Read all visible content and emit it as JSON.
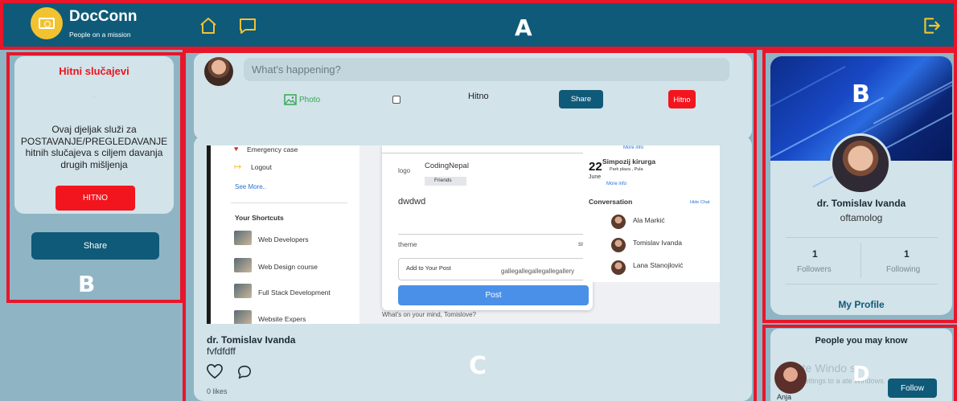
{
  "header": {
    "brand": "DocConn",
    "tagline": "People on a mission",
    "region_label": "A"
  },
  "left_panel": {
    "title": "Hitni slučajevi",
    "description": "Ovaj djeljak služi za POSTAVANJE/PREGLEDAVANJE hitnih slučajeva s ciljem davanja drugih mišljenja",
    "hitno_button": "HITNO",
    "share_button": "Share",
    "region_label": "B"
  },
  "composer": {
    "placeholder": "What's happening?",
    "photo_label": "Photo",
    "hitno_label": "Hitno",
    "share_button": "Share",
    "hitno_button": "Hitno"
  },
  "feed": {
    "region_label": "C",
    "screenshot": {
      "sidebar": {
        "emergency": "Emergency case",
        "logout": "Logout",
        "see_more": "See More..",
        "shortcuts_title": "Your Shortcuts",
        "shortcuts": [
          "Web Developers",
          "Web Design course",
          "Full Stack Development",
          "Website Expers"
        ]
      },
      "modal": {
        "user": "CodingNepal",
        "logo_alt": "logo",
        "friends": "Friends",
        "text": "dwdwd",
        "theme_alt": "theme",
        "smile_alt": "smil",
        "add_to_post": "Add to Your Post",
        "gallery": "gallegallegallegallegallery",
        "post_button": "Post"
      },
      "whats_on_mind": "What's on your mind, Tomislove?",
      "right": {
        "more_info_1": "More info",
        "event_day": "22",
        "event_month": "June",
        "event_title": "Simpozij kirurga",
        "event_place": "Park plaza , Pula",
        "more_info_2": "More info",
        "conversation": "Conversation",
        "hide_chat": "Hide Chat",
        "contacts": [
          "Ala Markić",
          "Tomislav Ivanda",
          "Lana Stanojlović"
        ]
      }
    },
    "post": {
      "author": "dr. Tomislav Ivanda",
      "text": "fvfdfdff",
      "likes": "0 likes"
    }
  },
  "profile": {
    "region_label": "B",
    "name": "dr. Tomislav Ivanda",
    "title": "oftamolog",
    "followers_count": "1",
    "followers_label": "Followers",
    "following_count": "1",
    "following_label": "Following",
    "my_profile": "My Profile"
  },
  "people": {
    "region_label": "D",
    "title": "People you may know",
    "person_name": "Anja",
    "follow_button": "Follow",
    "watermark_line1": "ate Windo  s",
    "watermark_line2": "Go to Settings to a    ate Windows."
  },
  "colors": {
    "header": "#0f5a78",
    "accent_red": "#e8162a",
    "brand_yellow": "#f2c230",
    "card": "#d2e3ea",
    "page_bg": "#8fb4c4"
  }
}
